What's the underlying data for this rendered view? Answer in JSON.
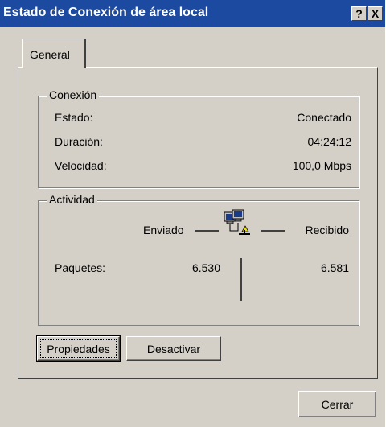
{
  "window": {
    "title": "Estado de Conexión de área local",
    "help_label": "?",
    "close_label": "X"
  },
  "tabs": [
    {
      "label": "General"
    }
  ],
  "connection": {
    "group_title": "Conexión",
    "rows": [
      {
        "label": "Estado:",
        "value": "Conectado"
      },
      {
        "label": "Duración:",
        "value": "04:24:12"
      },
      {
        "label": "Velocidad:",
        "value": "100,0 Mbps"
      }
    ]
  },
  "activity": {
    "group_title": "Actividad",
    "sent_label": "Enviado",
    "received_label": "Recibido",
    "packets_label": "Paquetes:",
    "packets_sent": "6.530",
    "packets_received": "6.581",
    "icon": "network-computers-icon"
  },
  "buttons": {
    "properties": "Propiedades",
    "disable": "Desactivar",
    "close": "Cerrar"
  },
  "colors": {
    "titlebar": "#1c4aa0",
    "face": "#d4d0c8"
  }
}
